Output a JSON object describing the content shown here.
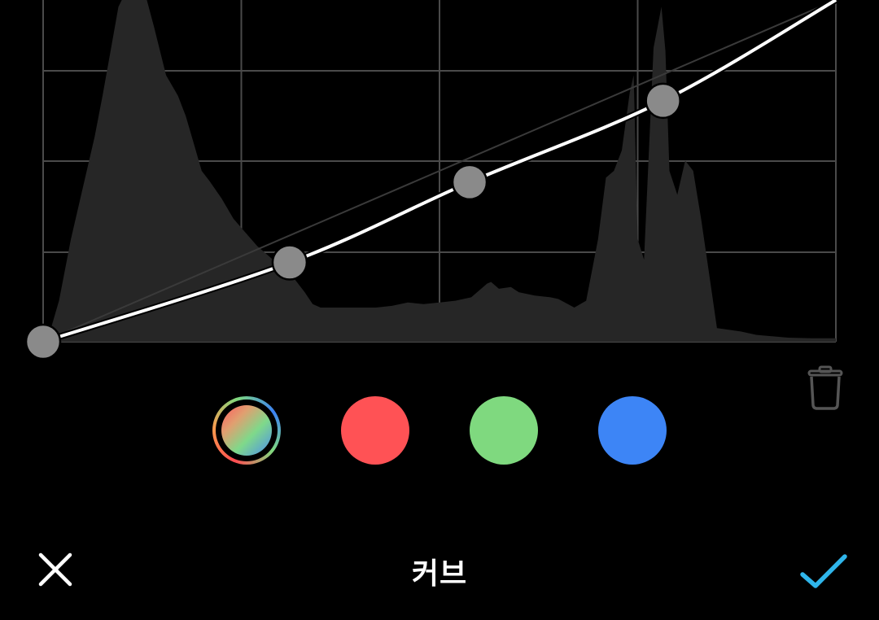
{
  "title": "커브",
  "colors": {
    "background": "#000000",
    "grid": "#4a4a4a",
    "histogram": "#262626",
    "curve": "#ffffff",
    "point": "#8a8a8a",
    "accent": "#2fb5ea",
    "red": "#ff5255",
    "green": "#7fd97f",
    "blue": "#3d85f6"
  },
  "curve_points": [
    {
      "input": 0,
      "output": 0
    },
    {
      "input": 0.311,
      "output": 0.232
    },
    {
      "input": 0.538,
      "output": 0.467
    },
    {
      "input": 0.782,
      "output": 0.705
    },
    {
      "input": 1,
      "output": 1
    }
  ],
  "histogram": [
    [
      0,
      0.0
    ],
    [
      0.01,
      0.04
    ],
    [
      0.02,
      0.12
    ],
    [
      0.035,
      0.3
    ],
    [
      0.05,
      0.45
    ],
    [
      0.065,
      0.6
    ],
    [
      0.075,
      0.72
    ],
    [
      0.085,
      0.85
    ],
    [
      0.095,
      0.98
    ],
    [
      0.11,
      1.05
    ],
    [
      0.125,
      1.05
    ],
    [
      0.14,
      0.92
    ],
    [
      0.155,
      0.78
    ],
    [
      0.17,
      0.72
    ],
    [
      0.18,
      0.66
    ],
    [
      0.19,
      0.58
    ],
    [
      0.2,
      0.5
    ],
    [
      0.21,
      0.47
    ],
    [
      0.225,
      0.42
    ],
    [
      0.24,
      0.36
    ],
    [
      0.255,
      0.32
    ],
    [
      0.27,
      0.28
    ],
    [
      0.285,
      0.25
    ],
    [
      0.3,
      0.22
    ],
    [
      0.315,
      0.19
    ],
    [
      0.33,
      0.145
    ],
    [
      0.34,
      0.11
    ],
    [
      0.35,
      0.1
    ],
    [
      0.36,
      0.1
    ],
    [
      0.38,
      0.1
    ],
    [
      0.4,
      0.1
    ],
    [
      0.42,
      0.1
    ],
    [
      0.44,
      0.105
    ],
    [
      0.46,
      0.115
    ],
    [
      0.48,
      0.11
    ],
    [
      0.5,
      0.115
    ],
    [
      0.52,
      0.12
    ],
    [
      0.53,
      0.125
    ],
    [
      0.54,
      0.13
    ],
    [
      0.56,
      0.17
    ],
    [
      0.565,
      0.175
    ],
    [
      0.575,
      0.155
    ],
    [
      0.59,
      0.16
    ],
    [
      0.6,
      0.145
    ],
    [
      0.62,
      0.135
    ],
    [
      0.64,
      0.13
    ],
    [
      0.65,
      0.125
    ],
    [
      0.67,
      0.1
    ],
    [
      0.685,
      0.12
    ],
    [
      0.7,
      0.3
    ],
    [
      0.71,
      0.48
    ],
    [
      0.72,
      0.5
    ],
    [
      0.73,
      0.56
    ],
    [
      0.74,
      0.73
    ],
    [
      0.745,
      0.78
    ],
    [
      0.75,
      0.3
    ],
    [
      0.758,
      0.24
    ],
    [
      0.77,
      0.86
    ],
    [
      0.78,
      0.98
    ],
    [
      0.785,
      0.85
    ],
    [
      0.79,
      0.5
    ],
    [
      0.8,
      0.43
    ],
    [
      0.81,
      0.53
    ],
    [
      0.82,
      0.5
    ],
    [
      0.83,
      0.36
    ],
    [
      0.84,
      0.2
    ],
    [
      0.85,
      0.04
    ],
    [
      0.88,
      0.03
    ],
    [
      0.9,
      0.02
    ],
    [
      0.94,
      0.012
    ],
    [
      0.97,
      0.01
    ],
    [
      1,
      0.01
    ]
  ],
  "icons": {
    "trash": "trash-icon",
    "cancel": "close-icon",
    "confirm": "checkmark-icon"
  },
  "channels": [
    {
      "id": "rgb",
      "selected": true
    },
    {
      "id": "red",
      "selected": false
    },
    {
      "id": "green",
      "selected": false
    },
    {
      "id": "blue",
      "selected": false
    }
  ]
}
